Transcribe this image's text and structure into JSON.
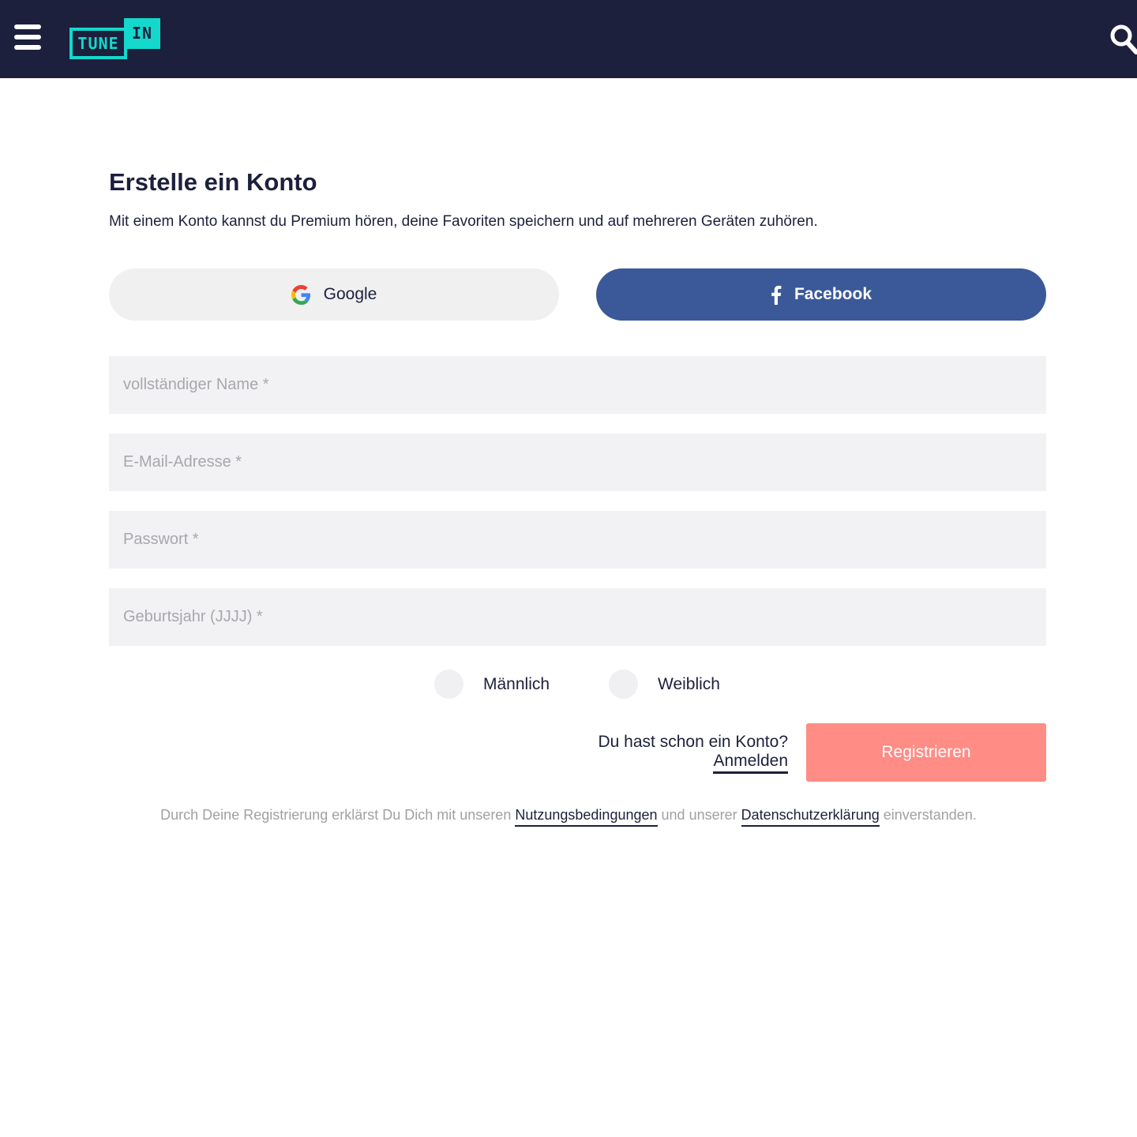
{
  "header": {
    "logo_tune": "TUNE",
    "logo_in": "IN",
    "colors": {
      "background": "#1c203c",
      "accent": "#14d8cc"
    },
    "menu_icon": "hamburger-menu-icon",
    "search_icon": "search-icon"
  },
  "signup": {
    "title": "Erstelle ein Konto",
    "subtitle": "Mit einem Konto kannst du Premium hören, deine Favoriten speichern und auf mehreren Geräten zuhören.",
    "google_label": "Google",
    "facebook_label": "Facebook",
    "fields": {
      "name_placeholder": "vollständiger Name *",
      "email_placeholder": "E-Mail-Adresse *",
      "password_placeholder": "Passwort *",
      "birth_year_placeholder": "Geburtsjahr (JJJJ) *"
    },
    "gender": {
      "male": "Männlich",
      "female": "Weiblich"
    },
    "have_account": "Du hast schon ein Konto?",
    "signin_link": "Anmelden",
    "register_button": "Registrieren",
    "terms": {
      "prefix": "Durch Deine Registrierung erklärst Du Dich mit unseren",
      "terms_link": "Nutzungsbedingungen",
      "middle": "und unserer",
      "privacy_link": "Datenschutzerklärung",
      "suffix": "einverstanden."
    },
    "colors": {
      "facebook": "#3b5998",
      "register": "#ff8c85",
      "field_bg": "#f2f2f4"
    }
  }
}
